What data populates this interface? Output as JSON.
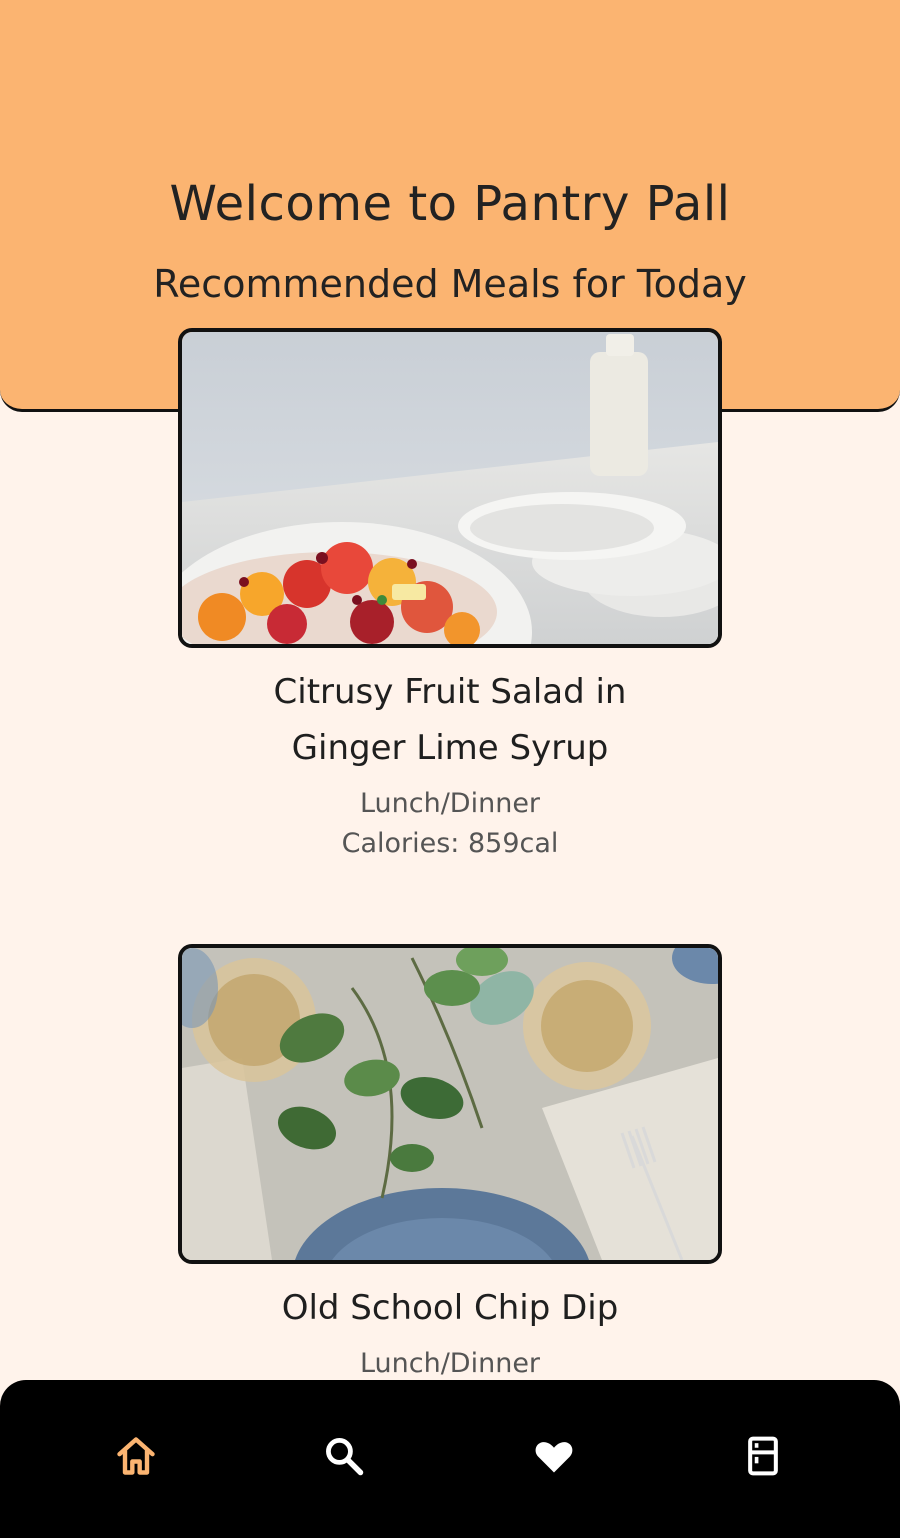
{
  "header": {
    "welcome": "Welcome to Pantry Pall",
    "subtitle": "Recommended Meals for Today"
  },
  "meals": [
    {
      "title_line1": "Citrusy Fruit Salad in",
      "title_line2": "Ginger Lime Syrup",
      "category": "Lunch/Dinner",
      "calories": "Calories: 859cal",
      "image_icon": "fruit-salad-photo"
    },
    {
      "title_line1": "Old School Chip Dip",
      "category": "Lunch/Dinner",
      "image_icon": "table-setting-photo"
    }
  ],
  "nav": {
    "items": [
      {
        "icon": "home-icon",
        "active": true
      },
      {
        "icon": "search-icon",
        "active": false
      },
      {
        "icon": "heart-icon",
        "active": false
      },
      {
        "icon": "fridge-icon",
        "active": false
      }
    ],
    "active_color": "#fbb471",
    "inactive_color": "#ffffff"
  },
  "colors": {
    "header_bg": "#fbb471",
    "page_bg": "#fff3eb",
    "nav_bg": "#000000"
  }
}
